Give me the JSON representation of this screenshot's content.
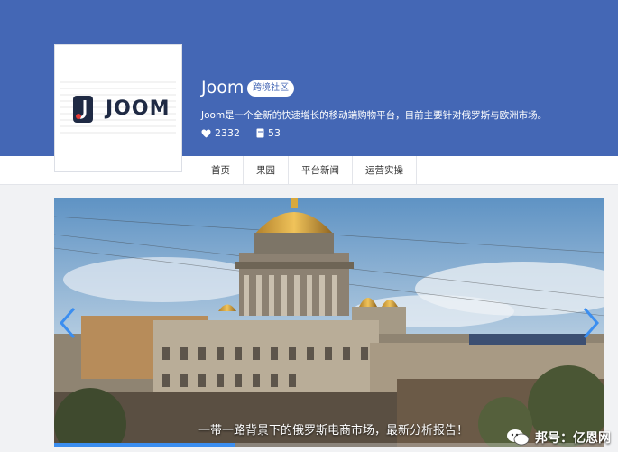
{
  "header": {
    "logo_text": "JOOM",
    "title": "Joom",
    "badge": "跨境社区",
    "description": "Joom是一个全新的快速增长的移动端购物平台，目前主要针对俄罗斯与欧洲市场。",
    "likes": "2332",
    "articles": "53"
  },
  "nav": {
    "tabs": [
      {
        "label": "首页"
      },
      {
        "label": "果园"
      },
      {
        "label": "平台新闻"
      },
      {
        "label": "运营实操"
      }
    ]
  },
  "carousel": {
    "caption": "一带一路背景下的俄罗斯电商市场，最新分析报告！",
    "progress": 0.33
  },
  "watermark": {
    "text": "邦号：亿恩网"
  },
  "colors": {
    "banner": "#4467b5",
    "accent": "#3b8ef0"
  }
}
